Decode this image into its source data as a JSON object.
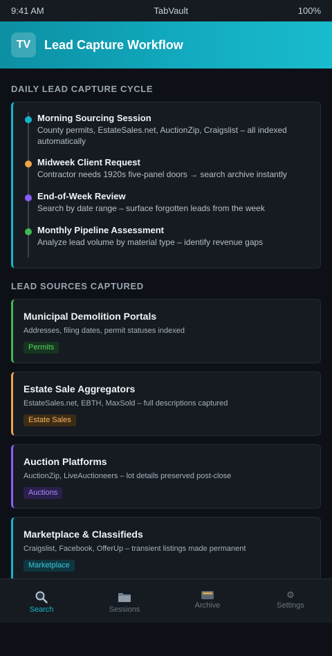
{
  "status": {
    "time": "9:41 AM",
    "app": "TabVault",
    "battery": "100%"
  },
  "header": {
    "logo": "TV",
    "title": "Lead Capture Workflow"
  },
  "cycle": {
    "heading": "DAILY LEAD CAPTURE CYCLE",
    "items": [
      {
        "title": "Morning Sourcing Session",
        "desc": "County permits, EstateSales.net, AuctionZip, Craigslist – all indexed automatically",
        "color": "#12b5c9"
      },
      {
        "title": "Midweek Client Request",
        "desc": "Contractor needs 1920s five-panel doors → search archive instantly",
        "color": "#f0a34a"
      },
      {
        "title": "End-of-Week Review",
        "desc": "Search by date range – surface forgotten leads from the week",
        "color": "#8b5cf6"
      },
      {
        "title": "Monthly Pipeline Assessment",
        "desc": "Analyze lead volume by material type – identify revenue gaps",
        "color": "#3fb950"
      }
    ]
  },
  "sources": {
    "heading": "LEAD SOURCES CAPTURED",
    "items": [
      {
        "title": "Municipal Demolition Portals",
        "desc": "Addresses, filing dates, permit statuses indexed",
        "badge": "Permits",
        "color": "#3fb950",
        "badge_bg": "#17351f",
        "badge_fg": "#56d364"
      },
      {
        "title": "Estate Sale Aggregators",
        "desc": "EstateSales.net, EBTH, MaxSold – full descriptions captured",
        "badge": "Estate Sales",
        "color": "#f0a34a",
        "badge_bg": "#3d2c14",
        "badge_fg": "#f5b45e"
      },
      {
        "title": "Auction Platforms",
        "desc": "AuctionZip, LiveAuctioneers – lot details preserved post-close",
        "badge": "Auctions",
        "color": "#8b5cf6",
        "badge_bg": "#2b1f4d",
        "badge_fg": "#a78bfa"
      },
      {
        "title": "Marketplace & Classifieds",
        "desc": "Craigslist, Facebook, OfferUp – transient listings made permanent",
        "badge": "Marketplace",
        "color": "#12b5c9",
        "badge_bg": "#0f3640",
        "badge_fg": "#3cc8d9"
      }
    ]
  },
  "tabs": [
    {
      "label": "Search",
      "icon": "search-icon"
    },
    {
      "label": "Sessions",
      "icon": "folder-icon"
    },
    {
      "label": "Archive",
      "icon": "archive-icon"
    },
    {
      "label": "Settings",
      "icon": "gear-icon"
    }
  ]
}
